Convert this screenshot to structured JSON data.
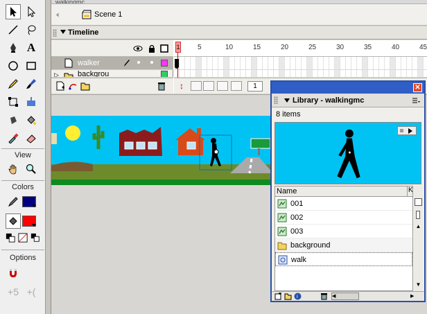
{
  "window": {
    "doc_title": "walkingmc"
  },
  "editbar": {
    "scene_label": "Scene 1"
  },
  "timeline": {
    "title": "Timeline",
    "layers": [
      {
        "name": "walker"
      },
      {
        "name": "backgrou"
      }
    ],
    "frame_numbers": [
      "1",
      "5",
      "10",
      "15",
      "20",
      "25",
      "30",
      "35",
      "40",
      "45"
    ],
    "current_frame": "1",
    "frame_field": "1"
  },
  "tools": {
    "view_label": "View",
    "colors_label": "Colors",
    "options_label": "Options",
    "stroke_color": "#000080",
    "fill_color": "#ff0000"
  },
  "library": {
    "title": "Library - walkingmc",
    "count": "8 items",
    "column_name": "Name",
    "column_kind": "K",
    "items": [
      {
        "name": "001",
        "icon": "graphic-symbol-icon"
      },
      {
        "name": "002",
        "icon": "graphic-symbol-icon"
      },
      {
        "name": "003",
        "icon": "graphic-symbol-icon"
      },
      {
        "name": "background",
        "icon": "folder-icon"
      },
      {
        "name": "walk",
        "icon": "movie-clip-icon"
      }
    ]
  },
  "colors": {
    "sky": "#00c3f3",
    "accent_title": "#2f5fc6",
    "close": "#e24a2b"
  }
}
